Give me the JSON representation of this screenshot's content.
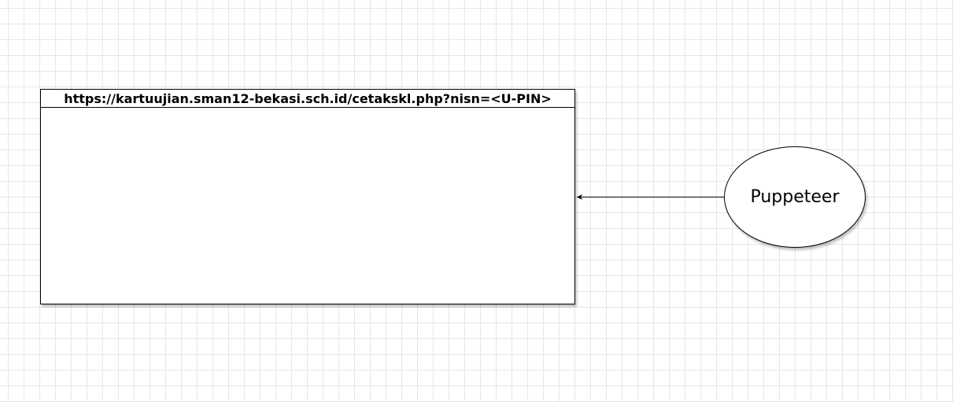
{
  "diagram": {
    "window": {
      "url_label": "https://kartuujian.sman12-bekasi.sch.id/cetakskl.php?nisn=<U-PIN>"
    },
    "actor": {
      "label": "Puppeteer"
    },
    "connector": {
      "from": "actor",
      "to": "window",
      "style": "arrow"
    }
  }
}
